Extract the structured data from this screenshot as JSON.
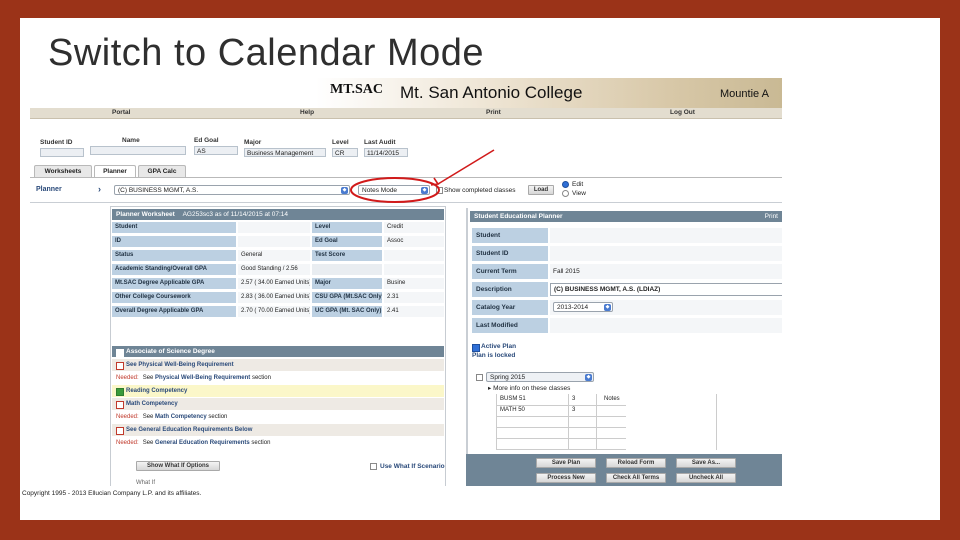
{
  "slide": {
    "title": "Switch to Calendar Mode"
  },
  "header": {
    "logo": "MT.SAC",
    "college": "Mt. San Antonio College",
    "mountie": "Mountie A"
  },
  "nav": {
    "portal": "Portal",
    "help": "Help",
    "print": "Print",
    "logout": "Log Out"
  },
  "student_info": {
    "student_id_label": "Student ID",
    "name_label": "Name",
    "ed_goal_label": "Ed Goal",
    "ed_goal_value": "AS",
    "major_label": "Major",
    "major_value": "Business Management",
    "level_label": "Level",
    "level_value": "CR",
    "last_audit_label": "Last Audit",
    "last_audit_value": "11/14/2015"
  },
  "tabs": [
    "Worksheets",
    "Planner",
    "GPA Calc"
  ],
  "planner_bar": {
    "label": "Planner",
    "program_select": "(C) BUSINESS MGMT, A.S.",
    "mode_select": "Notes Mode",
    "show_completed": "Show completed classes",
    "load_button": "Load",
    "edit": "Edit",
    "view": "View"
  },
  "worksheet": {
    "title": "Planner Worksheet",
    "asof": "AG253sc3 as of 11/14/2015 at 07:14",
    "rows": [
      {
        "l1": "Student",
        "v1": "",
        "l2": "Level",
        "v2": "Credit"
      },
      {
        "l1": "ID",
        "v1": "",
        "l2": "Ed Goal",
        "v2": "Assoc"
      },
      {
        "l1": "Status",
        "v1": "General",
        "l2": "Test Score",
        "v2": ""
      },
      {
        "l1": "Academic Standing/Overall GPA",
        "v1": "Good Standing / 2.56",
        "l2": "",
        "v2": ""
      },
      {
        "l1": "Mt.SAC Degree Applicable GPA",
        "v1": "2.57 ( 34.00 Earned Units)",
        "l2": "Major",
        "v2": "Busine"
      },
      {
        "l1": "Other College Coursework",
        "v1": "2.83 ( 36.00 Earned Units)",
        "l2": "CSU GPA (Mt.SAC Only)",
        "v2": "2.31"
      },
      {
        "l1": "Overall Degree Applicable GPA",
        "v1": "2.70 ( 70.00 Earned Units)",
        "l2": "UC GPA (Mt. SAC Only)",
        "v2": "2.41"
      }
    ],
    "degree_heading": "Associate of Science Degree",
    "degree_rows": [
      {
        "type": "req",
        "checked": false,
        "prefix": "",
        "text": "See Physical Well-Being Requirement",
        "bold": ""
      },
      {
        "type": "need",
        "checked": false,
        "prefix": "Needed:",
        "text": "See ",
        "bold": "Physical Well-Being Requirement",
        "suffix": " section"
      },
      {
        "type": "ok",
        "checked": true,
        "prefix": "",
        "text": "Reading Competency",
        "bold": ""
      },
      {
        "type": "req",
        "checked": false,
        "prefix": "",
        "text": "Math Competency",
        "bold": ""
      },
      {
        "type": "need",
        "checked": false,
        "prefix": "Needed:",
        "text": "See ",
        "bold": "Math Competency",
        "suffix": " section"
      },
      {
        "type": "req",
        "checked": false,
        "prefix": "",
        "text": "See General Education Requirements Below",
        "bold": ""
      },
      {
        "type": "need",
        "checked": false,
        "prefix": "Needed:",
        "text": "See ",
        "bold": "General Education Requirements",
        "suffix": " section"
      }
    ],
    "show_whatif": "Show What If Options",
    "use_whatif": "Use What If Scenario",
    "bottom_text": "What If"
  },
  "plan": {
    "title": "Student Educational Planner",
    "print": "Print",
    "rows": [
      {
        "label": "Student",
        "value": ""
      },
      {
        "label": "Student ID",
        "value": ""
      },
      {
        "label": "Current Term",
        "value": "Fall 2015"
      },
      {
        "label": "Description",
        "value": "(C) BUSINESS MGMT, A.S.  (LDIAZ)"
      },
      {
        "label": "Catalog Year",
        "value": "2013-2014"
      },
      {
        "label": "Last Modified",
        "value": ""
      }
    ],
    "active_plan": "Active Plan",
    "plan_locked": "Plan is locked",
    "term": "Spring 2015",
    "more_info": "More info on these classes",
    "courses": [
      {
        "course": "BUSM 51",
        "units": "3",
        "note": "Notes"
      },
      {
        "course": "MATH 50",
        "units": "3",
        "note": ""
      }
    ],
    "buttons": [
      "Save Plan",
      "Reload Form",
      "Save As...",
      "Process New",
      "Check All Terms",
      "Uncheck All"
    ]
  },
  "copyright": "Copyright 1995 - 2013 Ellucian Company L.P. and its affiliates.",
  "colors": {
    "frame": "#9b3318",
    "annotation": "#d11a1a",
    "section_header": "#6f8596",
    "label_cell": "#bcd0e2"
  }
}
